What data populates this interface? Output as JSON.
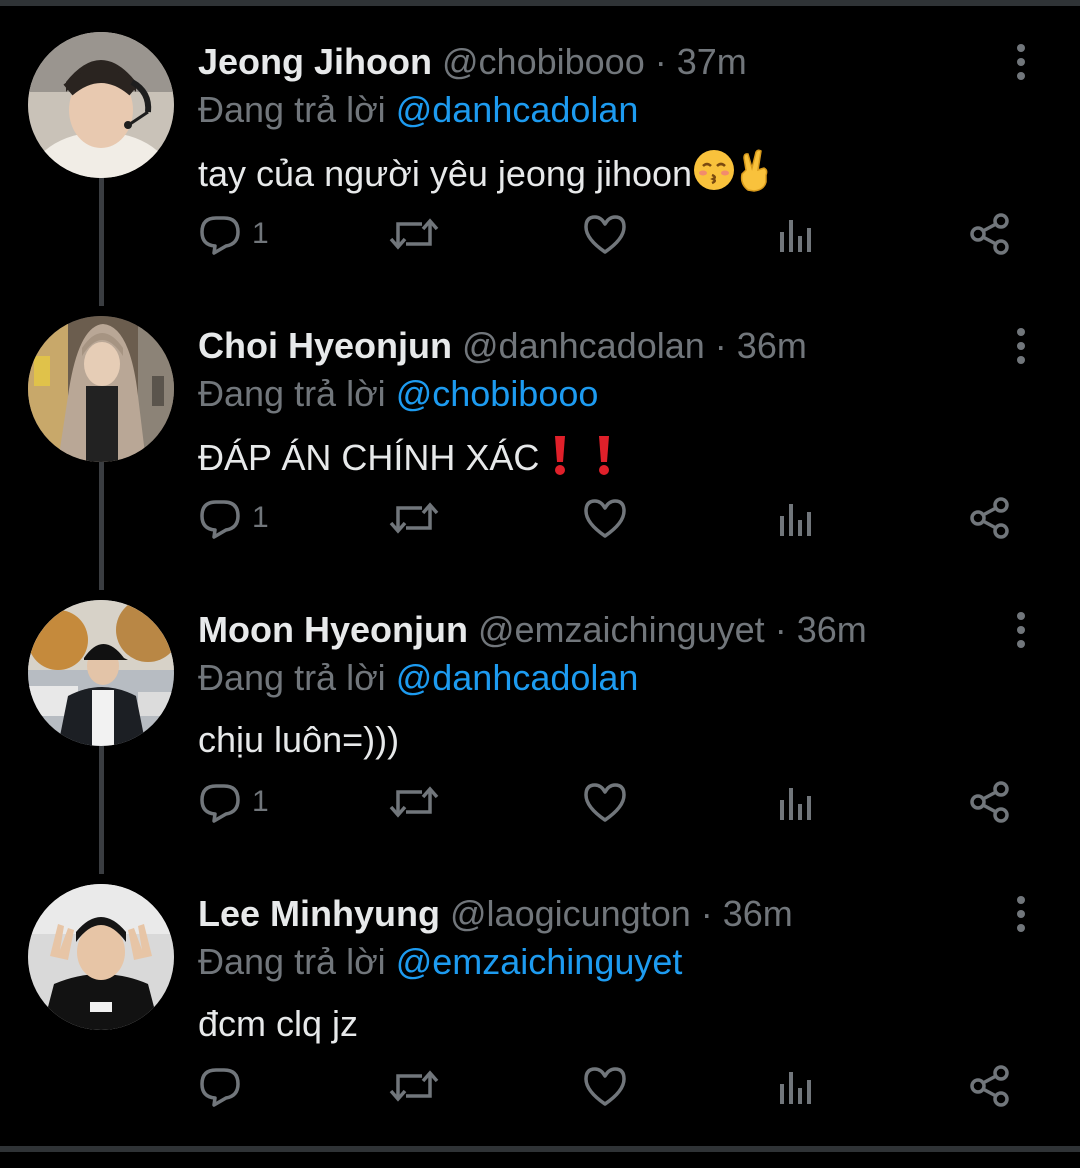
{
  "colors": {
    "background": "#000000",
    "text": "#e7e9ea",
    "muted": "#71767b",
    "link": "#1d9bf0",
    "thread_line": "#3a3d41",
    "emoji_yellow": "#f9c23c",
    "exclamation_red": "#e0202a"
  },
  "replying_prefix": "Đang trả lời",
  "tweets": [
    {
      "name": "Jeong Jihoon",
      "handle": "@chobibooo",
      "dot": "·",
      "time": "37m",
      "reply_to": "@danhcadolan",
      "text": "tay của người yêu jeong jihoon",
      "emojis": [
        "kissing-face-icon",
        "crossed-fingers-icon"
      ],
      "replies": "1",
      "avatar": "avatar-headset-photo"
    },
    {
      "name": "Choi Hyeonjun",
      "handle": "@danhcadolan",
      "dot": "·",
      "time": "36m",
      "reply_to": "@chobibooo",
      "text": "ĐÁP ÁN CHÍNH XÁC",
      "emojis": [
        "exclamation-icon",
        "exclamation-icon"
      ],
      "replies": "1",
      "avatar": "avatar-hoodie-photo"
    },
    {
      "name": "Moon Hyeonjun",
      "handle": "@emzaichinguyet",
      "dot": "·",
      "time": "36m",
      "reply_to": "@danhcadolan",
      "text": "chịu luôn=)))",
      "emojis": [],
      "replies": "1",
      "avatar": "avatar-cap-outdoor-photo"
    },
    {
      "name": "Lee Minhyung",
      "handle": "@laogicungton",
      "dot": "·",
      "time": "36m",
      "reply_to": "@emzaichinguyet",
      "text": "đcm clq jz",
      "emojis": [],
      "replies": "",
      "avatar": "avatar-peace-sign-photo"
    }
  ],
  "icons": {
    "reply": "reply-icon",
    "retweet": "retweet-icon",
    "like": "heart-icon",
    "views": "analytics-icon",
    "share": "share-icon",
    "more": "more-vertical-icon"
  }
}
